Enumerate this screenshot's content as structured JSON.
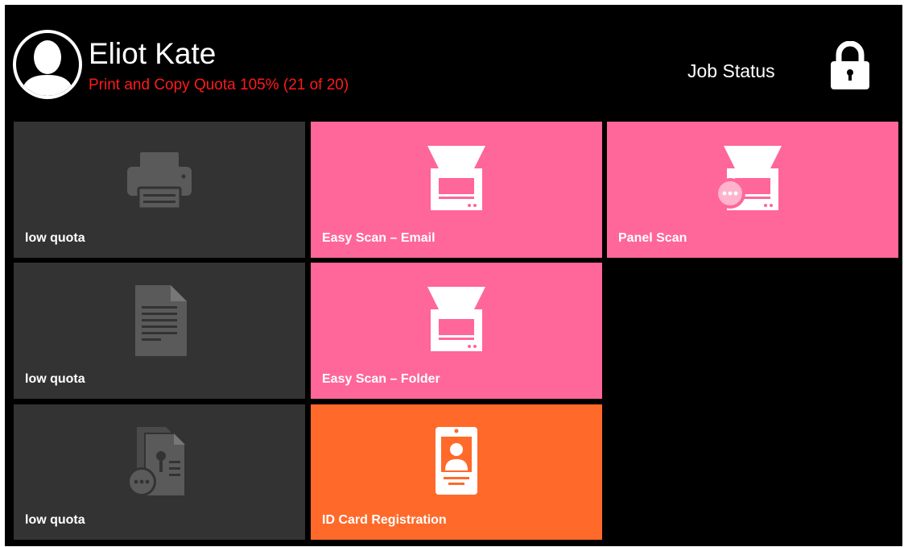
{
  "header": {
    "user_name": "Eliot Kate",
    "quota_text": "Print and Copy Quota 105% (21 of 20)",
    "job_status_label": "Job Status",
    "avatar_icon": "user-avatar-icon",
    "lock_icon": "lock-icon"
  },
  "tiles": {
    "print": {
      "label": "low quota",
      "icon": "printer-icon",
      "color": "#333333"
    },
    "easy_scan_email": {
      "label": "Easy Scan – Email",
      "icon": "scanner-icon",
      "color": "#ff6699"
    },
    "panel_scan": {
      "label": "Panel Scan",
      "icon": "scanner-menu-icon",
      "color": "#ff6699"
    },
    "copy": {
      "label": "low quota",
      "icon": "document-icon",
      "color": "#333333"
    },
    "easy_scan_folder": {
      "label": "Easy Scan – Folder",
      "icon": "scanner-icon",
      "color": "#ff6699"
    },
    "copy_options": {
      "label": "low quota",
      "icon": "documents-options-icon",
      "color": "#333333"
    },
    "id_card": {
      "label": "ID Card Registration",
      "icon": "id-card-icon",
      "color": "#ff6a2a"
    }
  },
  "colors": {
    "background": "#000000",
    "quota_warning": "#ff1a1a",
    "disabled_tile": "#333333",
    "scan_tile": "#ff6699",
    "id_tile": "#ff6a2a"
  }
}
